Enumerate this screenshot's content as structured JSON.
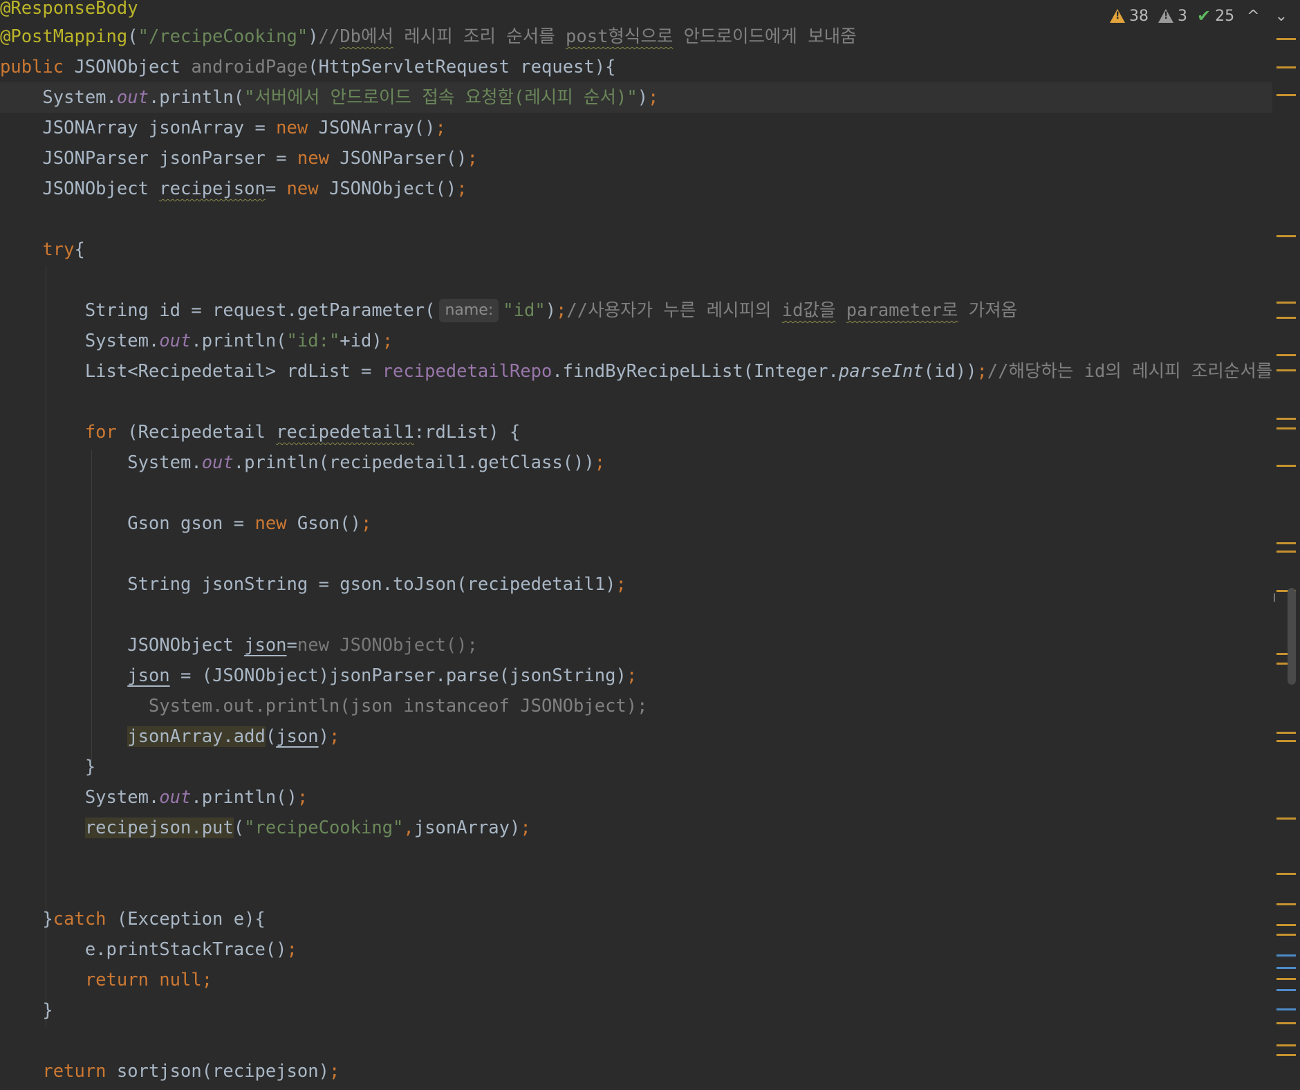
{
  "status_bar": {
    "warnings": "38",
    "weak_warnings": "3",
    "typos": "25",
    "prev_label": "^",
    "next_label": "⌄"
  },
  "code": {
    "l1": "@ResponseBody",
    "l2_ann": "@PostMapping",
    "l2_open": "(",
    "l2_str": "\"/recipeCooking\"",
    "l2_close": ")",
    "l2_c1": "//",
    "l2_c2": "Db에서",
    "l2_c3": " 레시피 조리 순서를 ",
    "l2_c4": "post형식으로",
    "l2_c5": " 안드로이드에게 보내줌",
    "l3_kw": "public",
    "l3_type": " JSONObject ",
    "l3_name": "androidPage",
    "l3_rest": "(HttpServletRequest request){",
    "l4_a": "    System.",
    "l4_out": "out",
    "l4_b": ".println(",
    "l4_str": "\"서버에서 안드로이드 접속 요청함(레시피 순서)\"",
    "l4_c": ")",
    "l4_semi": ";",
    "l5_a": "    JSONArray jsonArray = ",
    "l5_new": "new",
    "l5_b": " JSONArray()",
    "l5_semi": ";",
    "l6_a": "    JSONParser jsonParser = ",
    "l6_new": "new",
    "l6_b": " JSONParser()",
    "l6_semi": ";",
    "l7_a": "    JSONObject ",
    "l7_var": "recipejson",
    "l7_b": "= ",
    "l7_new": "new",
    "l7_c": " JSONObject()",
    "l7_semi": ";",
    "l8_kw": "    try",
    "l8_b": "{",
    "l9_a": "        String id = request.getParameter(",
    "l9_hint": "name:",
    "l9_str": "\"id\"",
    "l9_b": ")",
    "l9_semi": ";",
    "l9_c1": "//사용자가 누른 레시피의 ",
    "l9_c2": "id값을",
    "l9_c3": " ",
    "l9_c4": "parameter로",
    "l9_c5": " 가져옴",
    "l10_a": "        System.",
    "l10_out": "out",
    "l10_b": ".println(",
    "l10_str": "\"id:\"",
    "l10_c": "+id)",
    "l10_semi": ";",
    "l11_a": "        List<Recipedetail> rdList = ",
    "l11_repo": "recipedetailRepo",
    "l11_b": ".findByRecipeLList(Integer.",
    "l11_m": "parseInt",
    "l11_c": "(id))",
    "l11_semi": ";",
    "l11_cm": "//해당하는 id의 레시피 조리순서를",
    "l12_kw": "        for",
    "l12_a": " (Recipedetail ",
    "l12_var": "recipedetail1",
    "l12_b": ":rdList) {",
    "l13_a": "            System.",
    "l13_out": "out",
    "l13_b": ".println(recipedetail1.getClass())",
    "l13_semi": ";",
    "l14_a": "            Gson gson = ",
    "l14_new": "new",
    "l14_b": " Gson()",
    "l14_semi": ";",
    "l15_a": "            String jsonString = gson.toJson(recipedetail1)",
    "l15_semi": ";",
    "l16_a": "            JSONObject ",
    "l16_var": "json",
    "l16_b": "=",
    "l16_rest": "new JSONObject();",
    "l17_pre": "            ",
    "l17_var": "json",
    "l17_b": " = (JSONObject)jsonParser.parse(jsonString)",
    "l17_semi": ";",
    "l18_a": "              System.out.println(json instanceof JSONObject);",
    "l19_pre": "            ",
    "l19_hl": "jsonArray.add",
    "l19_b": "(",
    "l19_var": "json",
    "l19_c": ")",
    "l19_semi": ";",
    "l20": "        }",
    "l21_a": "        System.",
    "l21_out": "out",
    "l21_b": ".println()",
    "l21_semi": ";",
    "l22_pre": "        ",
    "l22_hl": "recipejson.put",
    "l22_b": "(",
    "l22_str": "\"recipeCooking\"",
    "l22_comma": ",",
    "l22_c": "jsonArray)",
    "l22_semi": ";",
    "l23_a": "    }",
    "l23_kw": "catch",
    "l23_b": " (Exception e){",
    "l24_a": "        e.printStackTrace()",
    "l24_semi": ";",
    "l25_kw": "        return null",
    "l25_semi": ";",
    "l26": "    }",
    "l27_kw": "    return",
    "l27_b": " sortjson(recipejson)",
    "l27_semi": ";"
  }
}
